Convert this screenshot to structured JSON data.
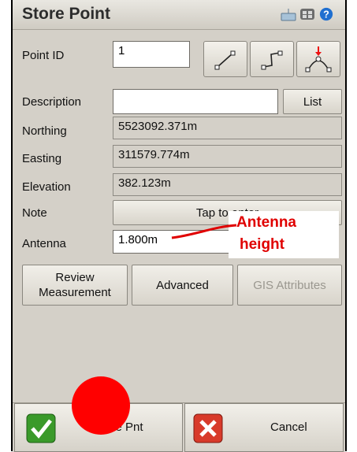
{
  "window": {
    "title": "Store Point"
  },
  "titlebar_icons": [
    "keyboard-icon",
    "status-icon",
    "help-icon"
  ],
  "form": {
    "point_id_label": "Point ID",
    "point_id_value": "1",
    "description_label": "Description",
    "description_value": "",
    "list_button": "List",
    "northing_label": "Northing",
    "northing_value": "5523092.371m",
    "easting_label": "Easting",
    "easting_value": "311579.774m",
    "elevation_label": "Elevation",
    "elevation_value": "382.123m",
    "note_label": "Note",
    "note_button": "Tap to enter",
    "antenna_label": "Antenna",
    "antenna_value": "1.800m"
  },
  "tool_icons": [
    "line-tool-icon",
    "polyline-tool-icon",
    "stakeout-point-icon"
  ],
  "buttons": {
    "review_line1": "Review",
    "review_line2": "Measurement",
    "advanced": "Advanced",
    "gis": "GIS Attributes"
  },
  "bottom": {
    "store_label": "Store Pnt",
    "cancel_label": "Cancel"
  },
  "annotation": {
    "line1": "Antenna",
    "line2": "height"
  },
  "colors": {
    "annotation": "#e00000",
    "marker": "#ff0000",
    "ok_green": "#3a9a2a",
    "cancel_red": "#d83a2a"
  }
}
